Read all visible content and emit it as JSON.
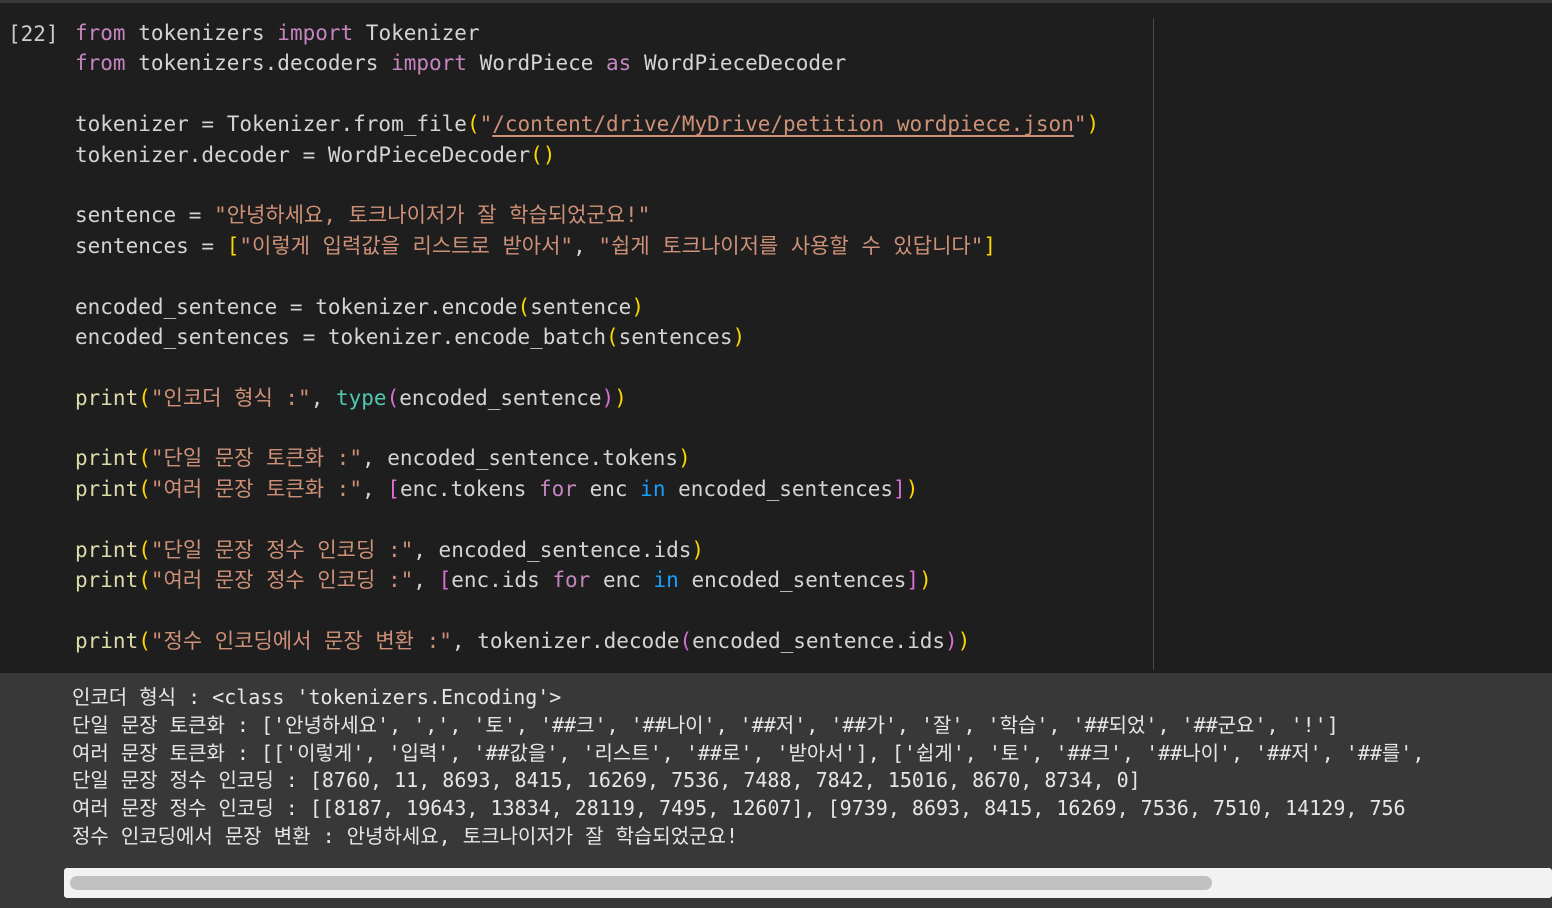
{
  "cell": {
    "execution_count": "[22]",
    "code_lines": [
      {
        "tokens": [
          {
            "t": "from",
            "c": "kw"
          },
          {
            "t": " tokenizers ",
            "c": "plain"
          },
          {
            "t": "import",
            "c": "kw"
          },
          {
            "t": " Tokenizer",
            "c": "plain"
          }
        ]
      },
      {
        "tokens": [
          {
            "t": "from",
            "c": "kw"
          },
          {
            "t": " tokenizers.decoders ",
            "c": "plain"
          },
          {
            "t": "import",
            "c": "kw"
          },
          {
            "t": " WordPiece ",
            "c": "plain"
          },
          {
            "t": "as",
            "c": "kw"
          },
          {
            "t": " WordPieceDecoder",
            "c": "plain"
          }
        ]
      },
      {
        "tokens": []
      },
      {
        "tokens": [
          {
            "t": "tokenizer = Tokenizer.from_file",
            "c": "plain"
          },
          {
            "t": "(",
            "c": "b1"
          },
          {
            "t": "\"",
            "c": "str"
          },
          {
            "t": "/content/drive/MyDrive/petition_wordpiece.json",
            "c": "path"
          },
          {
            "t": "\"",
            "c": "str"
          },
          {
            "t": ")",
            "c": "b1"
          }
        ]
      },
      {
        "tokens": [
          {
            "t": "tokenizer.decoder = WordPieceDecoder",
            "c": "plain"
          },
          {
            "t": "()",
            "c": "b1"
          }
        ]
      },
      {
        "tokens": []
      },
      {
        "tokens": [
          {
            "t": "sentence = ",
            "c": "plain"
          },
          {
            "t": "\"안녕하세요, 토크나이저가 잘 학습되었군요!\"",
            "c": "str"
          }
        ]
      },
      {
        "tokens": [
          {
            "t": "sentences = ",
            "c": "plain"
          },
          {
            "t": "[",
            "c": "b1"
          },
          {
            "t": "\"이렇게 입력값을 리스트로 받아서\"",
            "c": "str"
          },
          {
            "t": ", ",
            "c": "plain"
          },
          {
            "t": "\"쉽게 토크나이저를 사용할 수 있답니다\"",
            "c": "str"
          },
          {
            "t": "]",
            "c": "b1"
          }
        ]
      },
      {
        "tokens": []
      },
      {
        "tokens": [
          {
            "t": "encoded_sentence = tokenizer.encode",
            "c": "plain"
          },
          {
            "t": "(",
            "c": "b1"
          },
          {
            "t": "sentence",
            "c": "plain"
          },
          {
            "t": ")",
            "c": "b1"
          }
        ]
      },
      {
        "tokens": [
          {
            "t": "encoded_sentences = tokenizer.encode_batch",
            "c": "plain"
          },
          {
            "t": "(",
            "c": "b1"
          },
          {
            "t": "sentences",
            "c": "plain"
          },
          {
            "t": ")",
            "c": "b1"
          }
        ]
      },
      {
        "tokens": []
      },
      {
        "tokens": [
          {
            "t": "print",
            "c": "fn"
          },
          {
            "t": "(",
            "c": "b1"
          },
          {
            "t": "\"인코더 형식 :\"",
            "c": "str"
          },
          {
            "t": ", ",
            "c": "plain"
          },
          {
            "t": "type",
            "c": "bi"
          },
          {
            "t": "(",
            "c": "b2"
          },
          {
            "t": "encoded_sentence",
            "c": "plain"
          },
          {
            "t": ")",
            "c": "b2"
          },
          {
            "t": ")",
            "c": "b1"
          }
        ]
      },
      {
        "tokens": []
      },
      {
        "tokens": [
          {
            "t": "print",
            "c": "fn"
          },
          {
            "t": "(",
            "c": "b1"
          },
          {
            "t": "\"단일 문장 토큰화 :\"",
            "c": "str"
          },
          {
            "t": ", encoded_sentence.tokens",
            "c": "plain"
          },
          {
            "t": ")",
            "c": "b1"
          }
        ]
      },
      {
        "tokens": [
          {
            "t": "print",
            "c": "fn"
          },
          {
            "t": "(",
            "c": "b1"
          },
          {
            "t": "\"여러 문장 토큰화 :\"",
            "c": "str"
          },
          {
            "t": ", ",
            "c": "plain"
          },
          {
            "t": "[",
            "c": "b2"
          },
          {
            "t": "enc.tokens ",
            "c": "plain"
          },
          {
            "t": "for",
            "c": "kw"
          },
          {
            "t": " enc ",
            "c": "plain"
          },
          {
            "t": "in",
            "c": "b3"
          },
          {
            "t": " encoded_sentences",
            "c": "plain"
          },
          {
            "t": "]",
            "c": "b2"
          },
          {
            "t": ")",
            "c": "b1"
          }
        ]
      },
      {
        "tokens": []
      },
      {
        "tokens": [
          {
            "t": "print",
            "c": "fn"
          },
          {
            "t": "(",
            "c": "b1"
          },
          {
            "t": "\"단일 문장 정수 인코딩 :\"",
            "c": "str"
          },
          {
            "t": ", encoded_sentence.ids",
            "c": "plain"
          },
          {
            "t": ")",
            "c": "b1"
          }
        ]
      },
      {
        "tokens": [
          {
            "t": "print",
            "c": "fn"
          },
          {
            "t": "(",
            "c": "b1"
          },
          {
            "t": "\"여러 문장 정수 인코딩 :\"",
            "c": "str"
          },
          {
            "t": ", ",
            "c": "plain"
          },
          {
            "t": "[",
            "c": "b2"
          },
          {
            "t": "enc.ids ",
            "c": "plain"
          },
          {
            "t": "for",
            "c": "kw"
          },
          {
            "t": " enc ",
            "c": "plain"
          },
          {
            "t": "in",
            "c": "b3"
          },
          {
            "t": " encoded_sentences",
            "c": "plain"
          },
          {
            "t": "]",
            "c": "b2"
          },
          {
            "t": ")",
            "c": "b1"
          }
        ]
      },
      {
        "tokens": []
      },
      {
        "tokens": [
          {
            "t": "print",
            "c": "fn"
          },
          {
            "t": "(",
            "c": "b1"
          },
          {
            "t": "\"정수 인코딩에서 문장 변환 :\"",
            "c": "str"
          },
          {
            "t": ", tokenizer.decode",
            "c": "plain"
          },
          {
            "t": "(",
            "c": "b2"
          },
          {
            "t": "encoded_sentence.ids",
            "c": "plain"
          },
          {
            "t": ")",
            "c": "b2"
          },
          {
            "t": ")",
            "c": "b1"
          }
        ]
      }
    ]
  },
  "output": {
    "lines": [
      "인코더 형식 : <class 'tokenizers.Encoding'>",
      "단일 문장 토큰화 : ['안녕하세요', ',', '토', '##크', '##나이', '##저', '##가', '잘', '학습', '##되었', '##군요', '!']",
      "여러 문장 토큰화 : [['이렇게', '입력', '##값을', '리스트', '##로', '받아서'], ['쉽게', '토', '##크', '##나이', '##저', '##를',",
      "단일 문장 정수 인코딩 : [8760, 11, 8693, 8415, 16269, 7536, 7488, 7842, 15016, 8670, 8734, 0]",
      "여러 문장 정수 인코딩 : [[8187, 19643, 13834, 28119, 7495, 12607], [9739, 8693, 8415, 16269, 7536, 7510, 14129, 756",
      "정수 인코딩에서 문장 변환 : 안녕하세요, 토크나이저가 잘 학습되었군요!"
    ]
  },
  "colors": {
    "background": "#1e1e1e",
    "output_background": "#383838",
    "keyword": "#c586c0",
    "function": "#dcdcaa",
    "builtin": "#4ec9b0",
    "string": "#ce9178",
    "bracket_level1": "#ffd700",
    "bracket_level2": "#da70d6",
    "bracket_level3": "#179fff"
  }
}
